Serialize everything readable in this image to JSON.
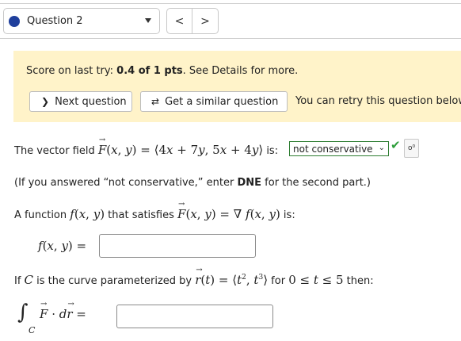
{
  "nav": {
    "question_label": "Question 2",
    "prev_symbol": "<",
    "next_symbol": ">"
  },
  "banner": {
    "score_prefix": "Score on last try: ",
    "score_value": "0.4 of 1 pts",
    "score_suffix": ". See Details for more.",
    "next_question_label": "Next question",
    "similar_question_label": "Get a similar question",
    "retry_text": "You can retry this question below"
  },
  "problem": {
    "field_prefix": "The vector field ",
    "field_suffix": " is:",
    "answer_selected": "not conservative",
    "note_prefix": "(If you answered “not conservative,” enter ",
    "note_bold": "DNE",
    "note_suffix": " for the second part.)",
    "potential_prefix": "A function ",
    "potential_middle": " that satisfies ",
    "potential_suffix": " is:",
    "curve_prefix": "If ",
    "curve_middle": " is the curve parameterized by ",
    "curve_for": " for ",
    "curve_suffix": " then:"
  },
  "colors": {
    "banner_bg": "#fff3c9",
    "status_dot": "#1f3f9c",
    "correct_green": "#2e9e3b"
  },
  "icons": {
    "next_question": "chevron-right-icon",
    "similar_question": "refresh-arrows-icon",
    "correct": "checkmark-icon",
    "symbol_picker": "keyboard-symbol-icon"
  }
}
